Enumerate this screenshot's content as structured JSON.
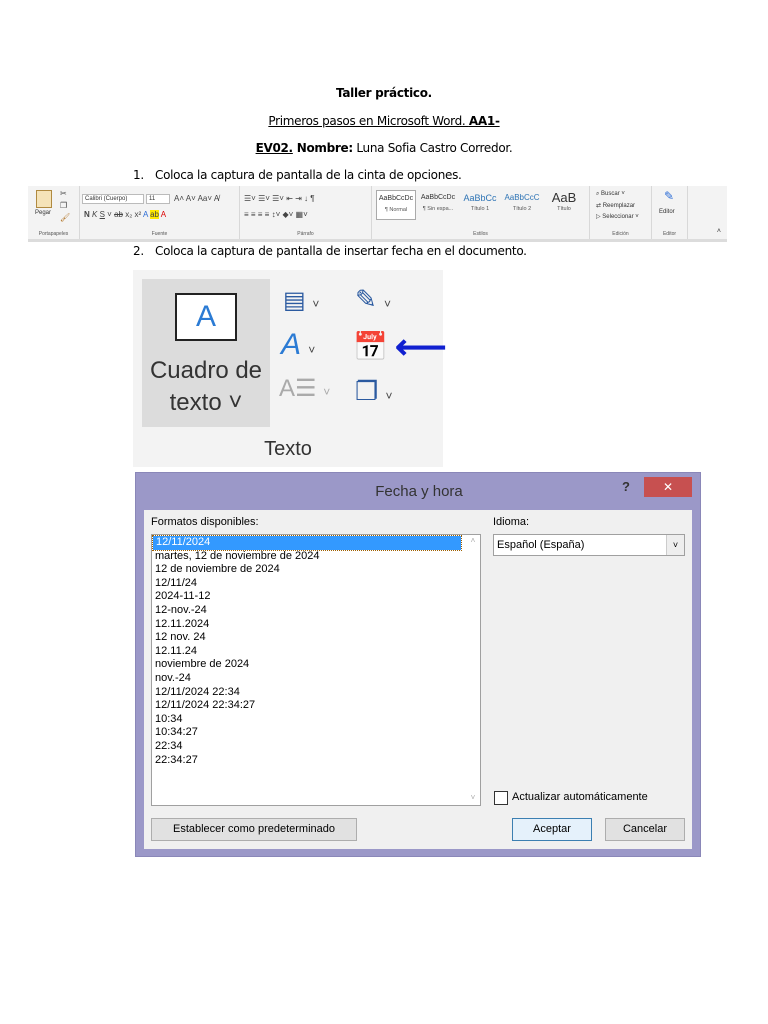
{
  "heading": "Taller práctico.",
  "subtitle_a": "Primeros pasos en Microsoft Word. ",
  "subtitle_b": "AA1-",
  "line3_a": "EV02.",
  "line3_b": " Nombre:",
  "line3_c": " Luna Sofia Castro Corredor.",
  "items": [
    {
      "num": "1.",
      "text": "Coloca la captura de pantalla de la cinta de opciones."
    },
    {
      "num": "2.",
      "text": "Coloca la captura de pantalla de insertar fecha en el documento."
    }
  ],
  "ribbon": {
    "paste": "Pegar",
    "clipboard": "Portapapeles",
    "font_name": "Calibri (Cuerpo)",
    "font_size": "11",
    "font_group": "Fuente",
    "paragraph": "Párrafo",
    "styles": [
      {
        "preview": "AaBbCcDc",
        "name": "¶ Normal"
      },
      {
        "preview": "AaBbCcDc",
        "name": "¶ Sin espa..."
      },
      {
        "preview": "AaBbCc",
        "name": "Título 1"
      },
      {
        "preview": "AaBbCcC",
        "name": "Título 2"
      },
      {
        "preview": "AaB",
        "name": "Título"
      }
    ],
    "styles_group": "Estilos",
    "find": "Buscar",
    "replace": "Reemplazar",
    "select": "Seleccionar",
    "editing": "Edición",
    "editor": "Editor",
    "editor_group": "Editor"
  },
  "texto": {
    "textbox_line1": "Cuadro de",
    "textbox_line2": "texto",
    "group": "Texto"
  },
  "dialog": {
    "title": "Fecha y hora",
    "help": "?",
    "close": "✕",
    "formats_label": "Formatos disponibles:",
    "formats": [
      "12/11/2024",
      "martes, 12 de noviembre de 2024",
      "12 de noviembre de 2024",
      "12/11/24",
      "2024-11-12",
      "12-nov.-24",
      "12.11.2024",
      "12 nov. 24",
      "12.11.24",
      "noviembre de 2024",
      "nov.-24",
      "12/11/2024 22:34",
      "12/11/2024 22:34:27",
      "10:34",
      "10:34:27",
      "22:34",
      "22:34:27"
    ],
    "language_label": "Idioma:",
    "language": "Español (España)",
    "auto_update": "Actualizar automáticamente",
    "set_default": "Establecer como predeterminado",
    "ok": "Aceptar",
    "cancel": "Cancelar"
  }
}
